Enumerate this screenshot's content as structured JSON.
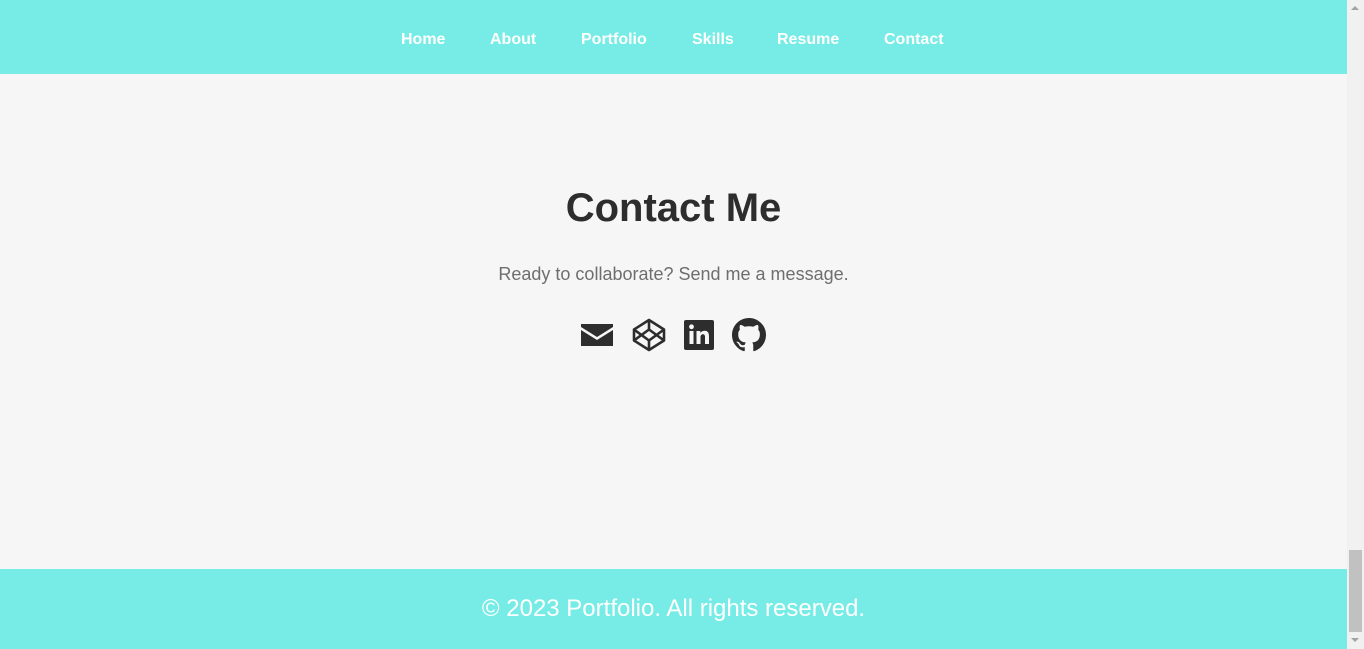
{
  "nav": {
    "items": [
      {
        "label": "Home"
      },
      {
        "label": "About"
      },
      {
        "label": "Portfolio"
      },
      {
        "label": "Skills"
      },
      {
        "label": "Resume"
      },
      {
        "label": "Contact"
      }
    ]
  },
  "contact": {
    "title": "Contact Me",
    "subtitle": "Ready to collaborate? Send me a message.",
    "social_icons": [
      "envelope-icon",
      "codepen-icon",
      "linkedin-icon",
      "github-icon"
    ]
  },
  "footer": {
    "text": "© 2023 Portfolio. All rights reserved."
  },
  "colors": {
    "accent": "#77ece6",
    "background": "#f6f6f6",
    "heading": "#2d2d2d",
    "subtext": "#6e6e6e",
    "nav_text": "#ffffff"
  }
}
